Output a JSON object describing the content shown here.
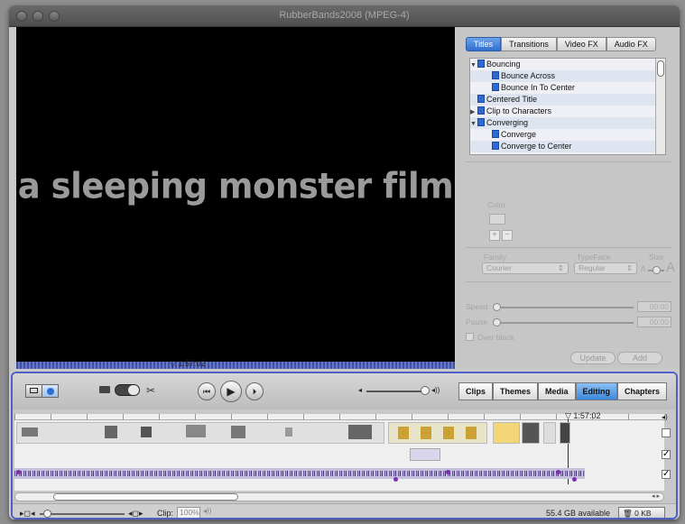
{
  "window": {
    "title": "RubberBands2008 (MPEG-4)"
  },
  "viewer": {
    "overlay_text": "a sleeping monster film",
    "playhead_time": "1:57:02"
  },
  "panel": {
    "tabs": [
      {
        "label": "Titles"
      },
      {
        "label": "Transitions"
      },
      {
        "label": "Video FX"
      },
      {
        "label": "Audio FX"
      }
    ],
    "selected_tab": "Titles",
    "titles": [
      {
        "label": "Bouncing",
        "indent": 0,
        "disclosure": "open"
      },
      {
        "label": "Bounce Across",
        "indent": 1,
        "disclosure": "none"
      },
      {
        "label": "Bounce In To Center",
        "indent": 1,
        "disclosure": "none"
      },
      {
        "label": "Centered Title",
        "indent": 0,
        "disclosure": "none"
      },
      {
        "label": "Clip to Characters",
        "indent": 0,
        "disclosure": "closed"
      },
      {
        "label": "Converging",
        "indent": 0,
        "disclosure": "open"
      },
      {
        "label": "Converge",
        "indent": 1,
        "disclosure": "none"
      },
      {
        "label": "Converge to Center",
        "indent": 1,
        "disclosure": "none"
      }
    ],
    "color_label": "Color",
    "plus": "+",
    "minus": "−",
    "family_label": "Family",
    "family_value": "Courier",
    "typeface_label": "TypeFace",
    "typeface_value": "Regular",
    "size_label": "Size",
    "size_small": "A",
    "size_large": "A",
    "speed_label": "Speed",
    "speed_value": "00:00",
    "pause_label": "Pause",
    "pause_value": "00:00",
    "over_black_label": "Over black",
    "update_label": "Update",
    "add_label": "Add"
  },
  "controls": {
    "rewind_icon": "⏮",
    "play_icon": "▶",
    "fullscreen_icon": "⏵",
    "volume_low": "◂",
    "volume_high": "◂))",
    "modes": [
      {
        "label": "Clips"
      },
      {
        "label": "Themes"
      },
      {
        "label": "Media"
      },
      {
        "label": "Editing"
      },
      {
        "label": "Chapters"
      }
    ],
    "selected_mode": "Editing"
  },
  "timeline": {
    "playhead_time": "1:57:02"
  },
  "status": {
    "clip_label": "Clip:",
    "clip_volume": "100%",
    "available": "55.4 GB available",
    "trash": "0 KB"
  },
  "colors": {
    "accent": "#3d88de",
    "selection_border": "#5160c8",
    "audio": "#6a5a9c"
  }
}
